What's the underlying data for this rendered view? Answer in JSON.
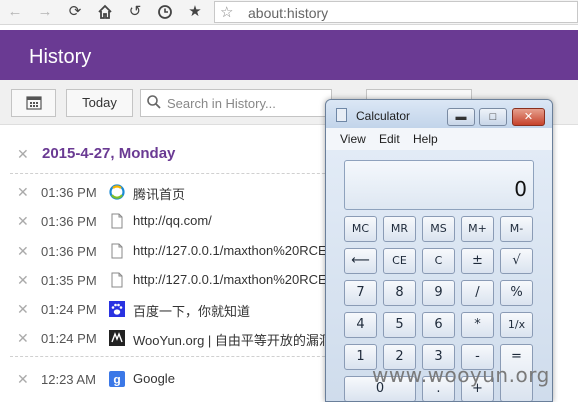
{
  "browser": {
    "url": "about:history"
  },
  "page": {
    "title": "History",
    "today_label": "Today",
    "search_placeholder": "Search in History..."
  },
  "history": {
    "date_heading": "2015-4-27, Monday",
    "rows": [
      {
        "time": "01:36 PM",
        "icon": "tencent-favicon",
        "title": "腾讯首页"
      },
      {
        "time": "01:36 PM",
        "icon": "page-icon",
        "title": "http://qq.com/"
      },
      {
        "time": "01:36 PM",
        "icon": "page-icon",
        "title": "http://127.0.0.1/maxthon%20RCE%"
      },
      {
        "time": "01:35 PM",
        "icon": "page-icon",
        "title": "http://127.0.0.1/maxthon%20RCE%"
      },
      {
        "time": "01:24 PM",
        "icon": "baidu-favicon",
        "title": "百度一下，你就知道"
      },
      {
        "time": "01:24 PM",
        "icon": "wooyun-favicon",
        "title": "WooYun.org | 自由平等开放的漏洞"
      },
      {
        "time": "12:23 AM",
        "icon": "google-favicon",
        "title": "Google"
      }
    ]
  },
  "calculator": {
    "title": "Calculator",
    "menu": [
      "View",
      "Edit",
      "Help"
    ],
    "display": "0",
    "keys": [
      "MC",
      "MR",
      "MS",
      "M+",
      "M-",
      "⟵",
      "CE",
      "C",
      "±",
      "√",
      "7",
      "8",
      "9",
      "/",
      "%",
      "4",
      "5",
      "6",
      "*",
      "1/x",
      "1",
      "2",
      "3",
      "-",
      "=",
      "0",
      ".",
      "+"
    ]
  },
  "watermark": "www.wooyun.org",
  "colors": {
    "header": "#6a3a93",
    "date_heading": "#6a3a93"
  }
}
